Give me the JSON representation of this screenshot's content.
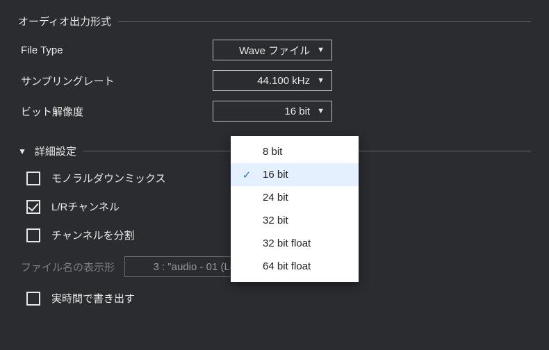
{
  "section_output": {
    "title": "オーディオ出力形式"
  },
  "file_type": {
    "label": "File Type",
    "value": "Wave ファイル"
  },
  "sample_rate": {
    "label": "サンプリングレート",
    "value": "44.100 kHz"
  },
  "bit_depth": {
    "label": "ビット解像度",
    "value": "16 bit"
  },
  "bit_depth_options": {
    "o0": "8 bit",
    "o1": "16 bit",
    "o2": "24 bit",
    "o3": "32 bit",
    "o4": "32 bit float",
    "o5": "64 bit float"
  },
  "section_advanced": {
    "title": "詳細設定"
  },
  "mono_downmix": {
    "label": "モノラルダウンミックス"
  },
  "lr_channel": {
    "label": "L/Rチャンネル"
  },
  "split_channels": {
    "label": "チャンネルを分割"
  },
  "filename_format": {
    "label": "ファイル名の表示形",
    "value": "3 : \"audio - 01 (Left).wav\""
  },
  "realtime_export": {
    "label": "実時間で書き出す"
  }
}
